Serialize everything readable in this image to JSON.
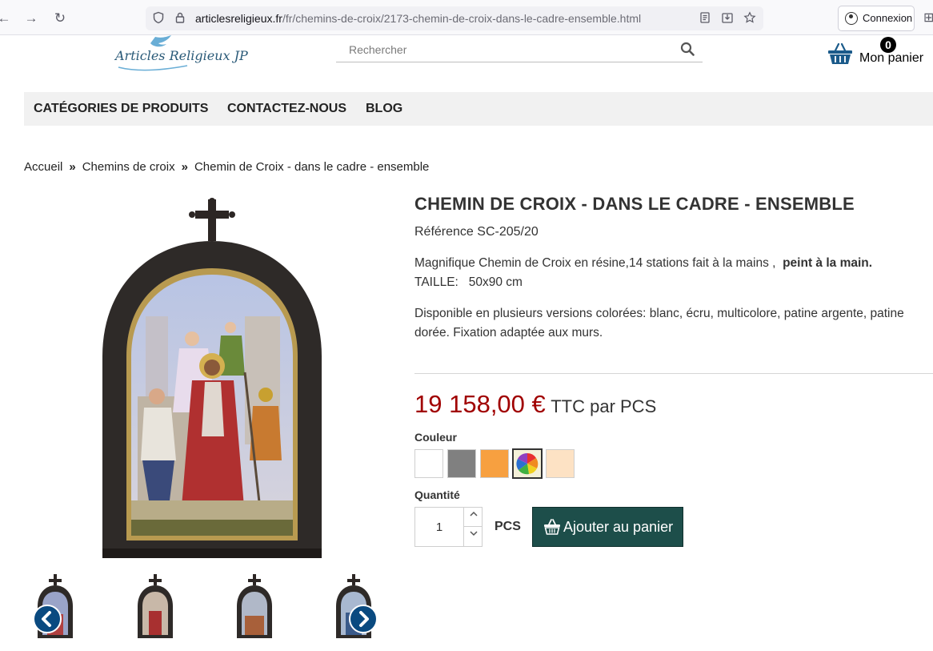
{
  "browser": {
    "url_host": "articlesreligieux.fr",
    "url_path": "/fr/chemins-de-croix/2173-chemin-de-croix-dans-le-cadre-ensemble.html",
    "connexion_label": "Connexion"
  },
  "header": {
    "logo_text": "Articles Religieux JP",
    "search_placeholder": "Rechercher",
    "cart_count": "0",
    "cart_label": "Mon panier"
  },
  "nav": {
    "items": [
      {
        "label": "CATÉGORIES DE PRODUITS"
      },
      {
        "label": "CONTACTEZ-NOUS"
      },
      {
        "label": "BLOG"
      }
    ]
  },
  "breadcrumb": {
    "items": [
      "Accueil",
      "Chemins de croix",
      "Chemin de Croix - dans le cadre - ensemble"
    ],
    "separator": "»"
  },
  "product": {
    "title": "CHEMIN DE CROIX - DANS LE CADRE - ENSEMBLE",
    "reference": "Référence SC-205/20",
    "desc_line1": "Magnifique Chemin de Croix en résine,14 stations fait à la mains ,",
    "desc_line1_bold": "peint à la main.",
    "desc_line2": "TAILLE:   50x90 cm",
    "desc_para2": "Disponible en plusieurs versions colorées: blanc, écru, multicolore, patine argente, patine dorée. Fixation adaptée aux murs.",
    "price_amount": "19 158,00 €",
    "price_unit": "TTC par PCS",
    "color_label": "Couleur",
    "colors": [
      {
        "name": "blanc",
        "hex": "#ffffff"
      },
      {
        "name": "gris",
        "hex": "#808080"
      },
      {
        "name": "orange",
        "hex": "#f7a040"
      },
      {
        "name": "multicolore",
        "hex": "multicolor",
        "selected": true
      },
      {
        "name": "écru",
        "hex": "#fde2c4"
      }
    ],
    "quantity_label": "Quantité",
    "quantity_value": "1",
    "quantity_unit": "PCS",
    "add_to_cart_label": "Ajouter au panier"
  },
  "gallery": {
    "prev_icon": "chevron-left-icon",
    "next_icon": "chevron-right-icon",
    "thumbnail_count": 4
  }
}
